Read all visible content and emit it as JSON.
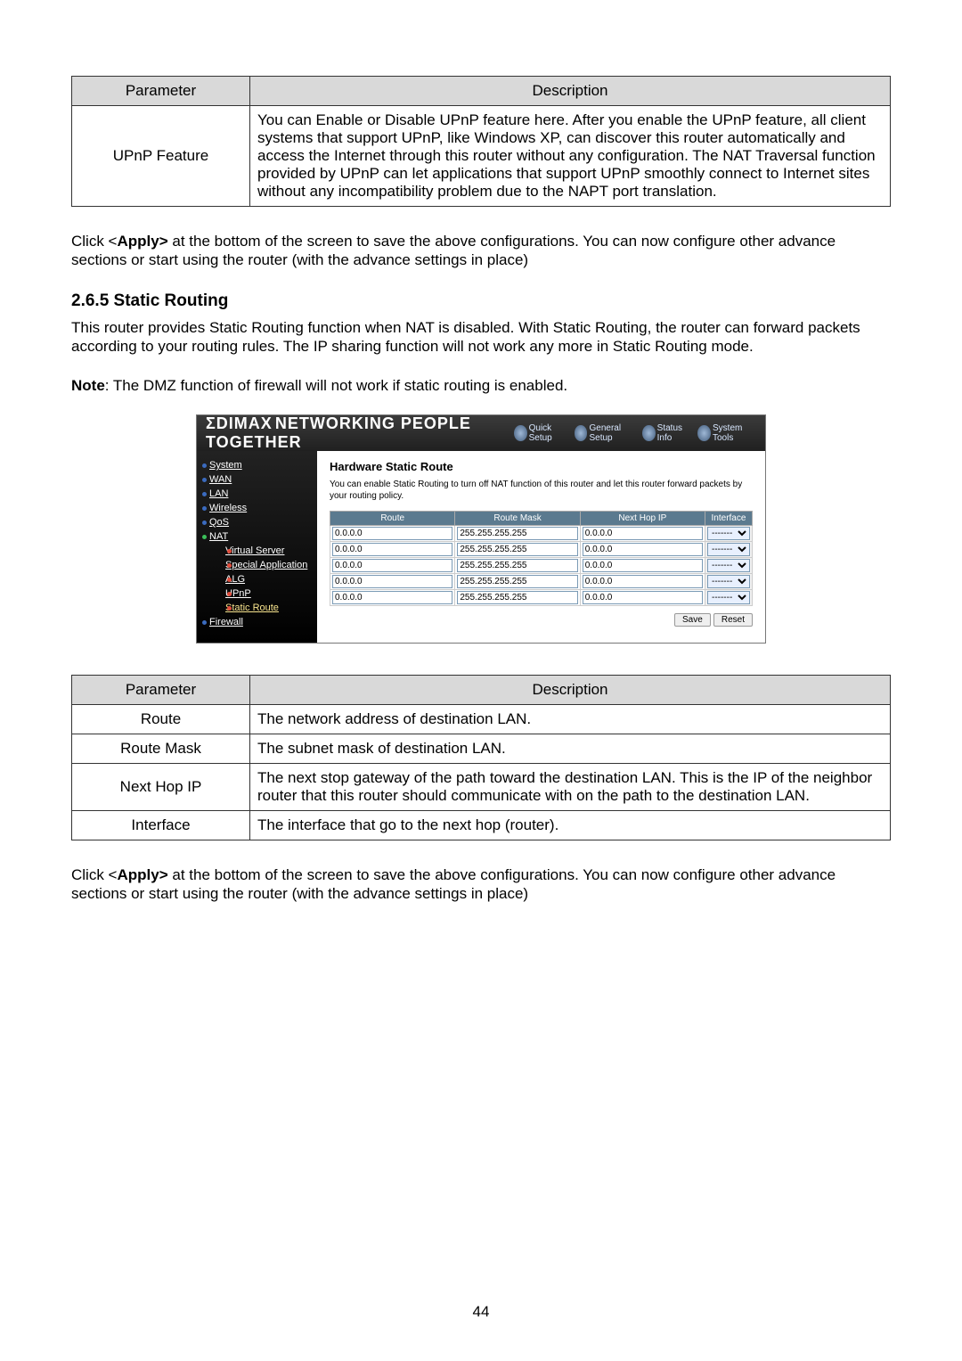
{
  "table1": {
    "headers": {
      "param": "Parameter",
      "desc": "Description"
    },
    "rows": [
      {
        "param": "UPnP Feature",
        "desc": "You can Enable or Disable UPnP feature here. After you enable the UPnP feature, all client systems that support UPnP, like Windows XP, can discover this router automatically and access the Internet through this router without any configuration. The NAT Traversal function provided by UPnP can let applications that support UPnP smoothly connect to Internet sites without any incompatibility problem due to the NAPT port translation."
      }
    ]
  },
  "para1_prefix": "Click <",
  "para1_bold": "Apply>",
  "para1_rest": " at the bottom of the screen to save the above configurations. You can now configure other advance sections or start using the router (with the advance settings in place)",
  "section_heading": "2.6.5 Static Routing",
  "section_body": "This router provides Static Routing function when NAT is disabled. With Static Routing, the router can forward packets according to your routing rules. The IP sharing function will not work any more in Static Routing mode.",
  "note_label": "Note",
  "note_body": ": The DMZ function of firewall will not work if static routing is enabled.",
  "router": {
    "logo": "ΣDIMAX",
    "logo_sub": "NETWORKING PEOPLE TOGETHER",
    "tabs": [
      "Quick Setup",
      "General Setup",
      "Status Info",
      "System Tools"
    ],
    "sidebar": {
      "main": [
        "System",
        "WAN",
        "LAN",
        "Wireless",
        "QoS",
        "NAT"
      ],
      "sub": [
        "Virtual Server",
        "Special Application",
        "ALG",
        "UPnP",
        "Static Route"
      ],
      "last": "Firewall"
    },
    "title": "Hardware Static Route",
    "hint": "You can enable Static Routing to turn off NAT function of this router and let this router forward packets by your routing policy.",
    "columns": [
      "Route",
      "Route Mask",
      "Next Hop IP",
      "Interface"
    ],
    "rows": [
      {
        "route": "0.0.0.0",
        "mask": "255.255.255.255",
        "hop": "0.0.0.0",
        "iface": "-------"
      },
      {
        "route": "0.0.0.0",
        "mask": "255.255.255.255",
        "hop": "0.0.0.0",
        "iface": "-------"
      },
      {
        "route": "0.0.0.0",
        "mask": "255.255.255.255",
        "hop": "0.0.0.0",
        "iface": "-------"
      },
      {
        "route": "0.0.0.0",
        "mask": "255.255.255.255",
        "hop": "0.0.0.0",
        "iface": "-------"
      },
      {
        "route": "0.0.0.0",
        "mask": "255.255.255.255",
        "hop": "0.0.0.0",
        "iface": "-------"
      }
    ],
    "buttons": {
      "save": "Save",
      "reset": "Reset"
    }
  },
  "table2": {
    "headers": {
      "param": "Parameter",
      "desc": "Description"
    },
    "rows": [
      {
        "param": "Route",
        "desc": "The network address of destination LAN."
      },
      {
        "param": "Route Mask",
        "desc": "The subnet mask of destination LAN."
      },
      {
        "param": "Next Hop IP",
        "desc": "The next stop gateway of the path toward the destination LAN. This is the IP of the neighbor router that this router should communicate with on the path to the destination LAN."
      },
      {
        "param": "Interface",
        "desc": "The interface that go to the next hop (router)."
      }
    ]
  },
  "page_number": "44"
}
